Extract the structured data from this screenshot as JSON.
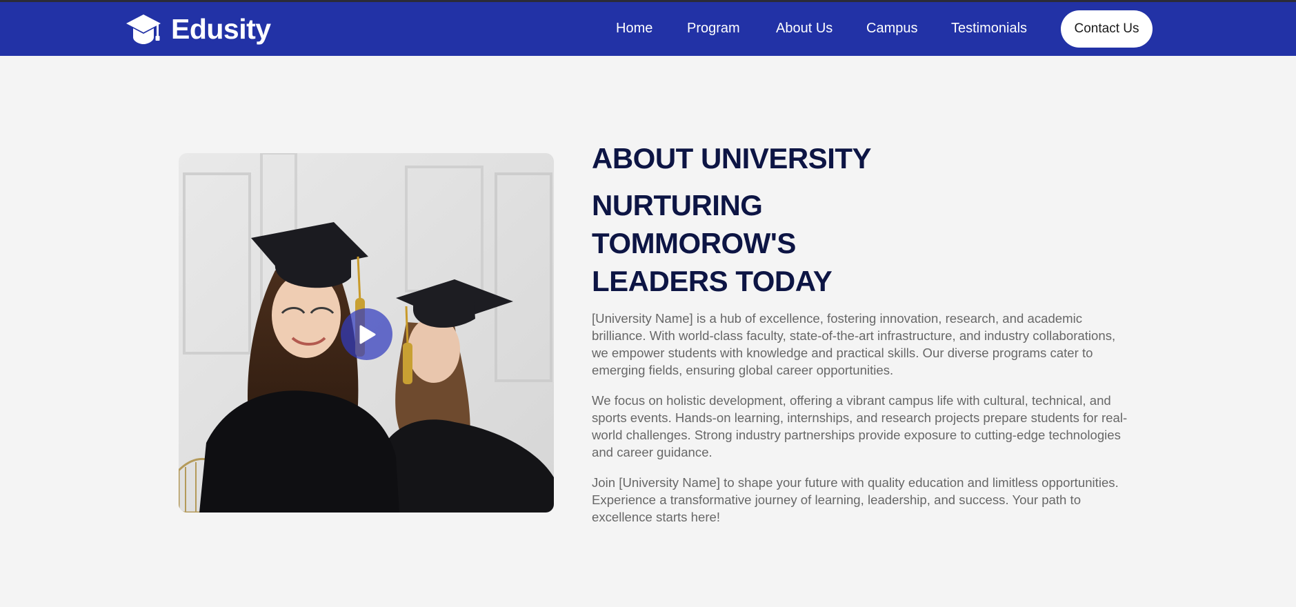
{
  "brand": {
    "name": "Edusity"
  },
  "nav": {
    "links": [
      "Home",
      "Program",
      "About Us",
      "Campus",
      "Testimonials"
    ],
    "contact_label": "Contact Us"
  },
  "about": {
    "title": "ABOUT UNIVERSITY",
    "headline_lines": [
      "NURTURING",
      "TOMMOROW'S",
      "LEADERS TODAY"
    ],
    "paragraphs": [
      "[University Name] is a hub of excellence, fostering innovation, research, and academic brilliance. With world-class faculty, state-of-the-art infrastructure, and industry collaborations, we empower students with knowledge and practical skills. Our diverse programs cater to emerging fields, ensuring global career opportunities.",
      "We focus on holistic development, offering a vibrant campus life with cultural, technical, and sports events. Hands-on learning, internships, and research projects prepare students for real-world challenges. Strong industry partnerships provide exposure to cutting-edge technologies and career guidance.",
      "Join [University Name] to shape your future with quality education and limitless opportunities. Experience a transformative journey of learning, leadership, and success. Your path to excellence starts here!"
    ]
  },
  "icons": {
    "logo": "graduation-cap-icon",
    "play": "play-icon"
  },
  "colors": {
    "navbar": "#2232a6",
    "heading": "#0d1544",
    "body_text": "#676767",
    "page_bg": "#f4f4f4",
    "play_button": "#323cbe"
  }
}
